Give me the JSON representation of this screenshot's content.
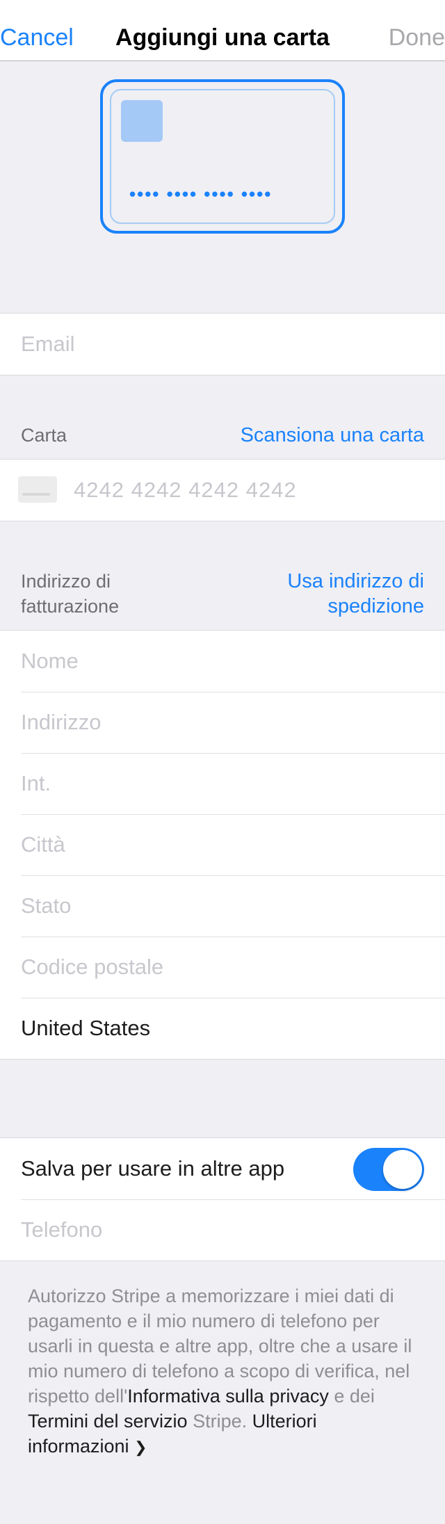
{
  "nav": {
    "cancel_label": "Cancel",
    "title": "Aggiungi una carta",
    "done_label": "Done"
  },
  "card_preview": {
    "number_masked": "•••• •••• •••• ••••"
  },
  "email": {
    "placeholder": "Email"
  },
  "card_section": {
    "label": "Carta",
    "scan_label": "Scansiona una carta",
    "number_placeholder": "4242 4242 4242 4242",
    "icon": "card-icon"
  },
  "billing_section": {
    "label_line1": "Indirizzo di",
    "label_line2": "fatturazione",
    "action_line1": "Usa indirizzo di",
    "action_line2": "spedizione",
    "fields": {
      "name": "Nome",
      "address": "Indirizzo",
      "apt": "Int.",
      "city": "Città",
      "state": "Stato",
      "postal": "Codice postale",
      "country": "United States"
    }
  },
  "save_section": {
    "save_label": "Salva per usare in altre app",
    "toggle_on": true,
    "phone_placeholder": "Telefono"
  },
  "legal": {
    "text1": "Autorizzo Stripe a memorizzare i miei dati di pagamento e il mio numero di telefono per usarli in questa e altre app, oltre che a usare il mio numero di telefono a scopo di verifica, nel rispetto dell'",
    "privacy_link": "Informativa sulla privacy",
    "text2": " e dei ",
    "terms_link": "Termini del servizio",
    "text3": " Stripe. ",
    "more_link": "Ulteriori informazioni",
    "chevron": "❯"
  },
  "colors": {
    "accent": "#1a82fb",
    "background": "#efeff4",
    "placeholder": "#c7c7cd",
    "secondary_text": "#6d6d72"
  }
}
